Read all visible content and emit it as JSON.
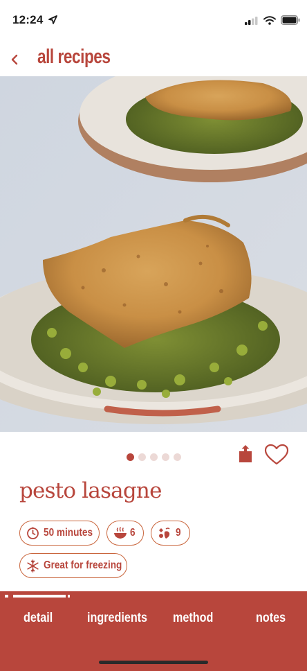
{
  "status_bar": {
    "time": "12:24"
  },
  "nav": {
    "back_icon": "chevron-left-icon",
    "title": "all recipes"
  },
  "hero": {
    "image_alt": "pesto lasagne in a ceramic bowl",
    "carousel_page": 1,
    "carousel_total": 5
  },
  "actions": {
    "share_icon": "share-icon",
    "favorite_icon": "heart-icon"
  },
  "recipe": {
    "title": "pesto lasagne",
    "time": "50 minutes",
    "servings": "6",
    "difficulty_count": "9",
    "tag": "Great for freezing"
  },
  "tabs": [
    {
      "label": "detail",
      "active": true
    },
    {
      "label": "ingredients",
      "active": false
    },
    {
      "label": "method",
      "active": false
    },
    {
      "label": "notes",
      "active": false
    }
  ],
  "colors": {
    "accent": "#b8463c",
    "chip_border": "#c9653c",
    "dot_inactive": "#ecd9d6"
  }
}
